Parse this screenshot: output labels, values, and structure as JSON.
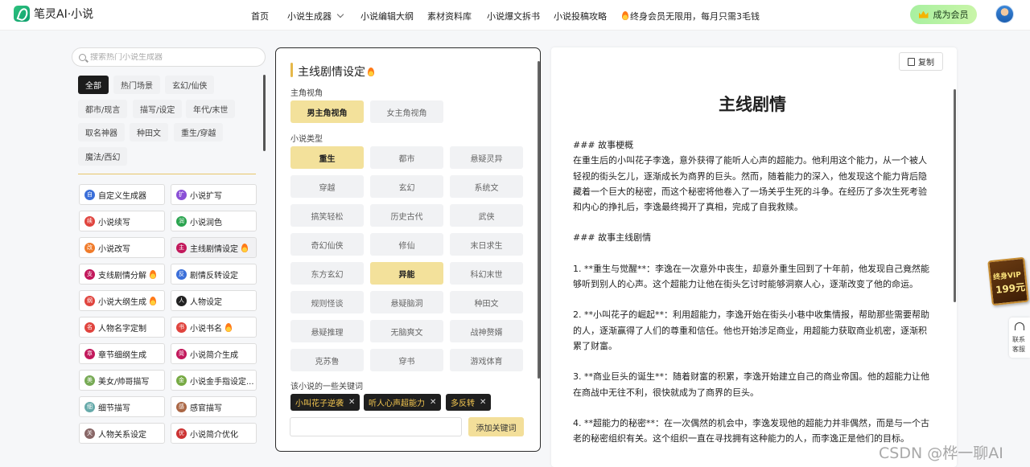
{
  "header": {
    "logo_text": "笔灵AI·小说",
    "nav": [
      {
        "label": "首页"
      },
      {
        "label": "小说生成器"
      },
      {
        "label": "小说编辑大纲"
      },
      {
        "label": "素材资料库"
      },
      {
        "label": "小说爆文拆书"
      },
      {
        "label": "小说投稿攻略"
      },
      {
        "label": "终身会员无限用，每月只需3毛钱"
      }
    ],
    "vip_button": "成为会员"
  },
  "left": {
    "search_placeholder": "搜索热门小说生成器",
    "categories": [
      "全部",
      "热门场景",
      "玄幻/仙侠",
      "都市/现言",
      "描写/设定",
      "年代/末世",
      "取名神器",
      "种田文",
      "重生/穿越",
      "魔法/西幻"
    ],
    "tools": [
      {
        "label": "自定义生成器",
        "icon": "自"
      },
      {
        "label": "小说扩写",
        "icon": "扩"
      },
      {
        "label": "小说续写",
        "icon": "续"
      },
      {
        "label": "小说润色",
        "icon": "润"
      },
      {
        "label": "小说改写",
        "icon": "改"
      },
      {
        "label": "主线剧情设定",
        "icon": "主"
      },
      {
        "label": "支线剧情分解",
        "icon": "支"
      },
      {
        "label": "剧情反转设定",
        "icon": "反"
      },
      {
        "label": "小说大纲生成",
        "icon": "纲"
      },
      {
        "label": "人物设定",
        "icon": "人"
      },
      {
        "label": "人物名字定制",
        "icon": "名"
      },
      {
        "label": "小说书名",
        "icon": "书"
      },
      {
        "label": "章节细纲生成",
        "icon": "章"
      },
      {
        "label": "小说简介生成",
        "icon": "简"
      },
      {
        "label": "美女/帅哥描写",
        "icon": "美"
      },
      {
        "label": "小说金手指设定...",
        "icon": "金"
      },
      {
        "label": "细节描写",
        "icon": "细"
      },
      {
        "label": "感官描写",
        "icon": "感"
      },
      {
        "label": "人物关系设定",
        "icon": "关"
      },
      {
        "label": "小说简介优化",
        "icon": "优"
      }
    ]
  },
  "middle": {
    "title": "主线剧情设定",
    "pov_label": "主角视角",
    "pov_options": [
      "男主角视角",
      "女主角视角"
    ],
    "pov_selected": "男主角视角",
    "genre_label": "小说类型",
    "genres": [
      "重生",
      "都市",
      "悬疑灵异",
      "穿越",
      "玄幻",
      "系统文",
      "搞笑轻松",
      "历史古代",
      "武侠",
      "奇幻仙侠",
      "修仙",
      "末日求生",
      "东方玄幻",
      "异能",
      "科幻末世",
      "规则怪谈",
      "悬疑脑洞",
      "种田文",
      "悬疑推理",
      "无脑爽文",
      "战神赘婿",
      "克苏鲁",
      "穿书",
      "游戏体育"
    ],
    "genres_selected": [
      "重生",
      "异能"
    ],
    "keywords_label": "该小说的一些关键词",
    "keywords": [
      "小叫花子逆袭",
      "听人心声超能力",
      "多反转"
    ],
    "add_keyword": "添加关键词"
  },
  "right": {
    "copy_label": "复制",
    "doc_title": "主线剧情",
    "paragraphs": [
      "### 故事梗概",
      "在重生后的小叫花子李逸，意外获得了能听人心声的超能力。他利用这个能力，从一个被人轻视的街头乞儿，逐渐成长为商界的巨头。然而，随着能力的深入，他发现这个能力背后隐藏着一个巨大的秘密，而这个秘密将他卷入了一场关乎生死的斗争。在经历了多次生死考验和内心的挣扎后，李逸最终揭开了真相，完成了自我救赎。",
      "",
      "### 故事主线剧情",
      "",
      "1. **重生与觉醒**：李逸在一次意外中丧生，却意外重生回到了十年前，他发现自己竟然能够听到别人的心声。这个超能力让他在街头乞讨时能够洞察人心，逐渐改变了他的命运。",
      "",
      "2. **小叫花子的崛起**：利用超能力，李逸开始在街头小巷中收集情报，帮助那些需要帮助的人，逐渐赢得了人们的尊重和信任。他也开始涉足商业，用超能力获取商业机密，逐渐积累了财富。",
      "",
      "3. **商业巨头的诞生**：随着财富的积累，李逸开始建立自己的商业帝国。他的超能力让他在商战中无往不利，很快就成为了商界的巨头。",
      "",
      "4. **超能力的秘密**：在一次偶然的机会中，李逸发现他的超能力并非偶然，而是与一个古老的秘密组织有关。这个组织一直在寻找拥有这种能力的人，而李逸正是他们的目标。"
    ]
  },
  "float": {
    "vip_line1": "终身VIP",
    "vip_line2": "199元",
    "service_line1": "联系",
    "service_line2": "客服"
  },
  "watermark": "CSDN @桦一聊AI",
  "colors": {
    "accent_gold": "#f3e19b",
    "dark": "#1f1f1f",
    "vip_green": "#a8f0a0"
  }
}
